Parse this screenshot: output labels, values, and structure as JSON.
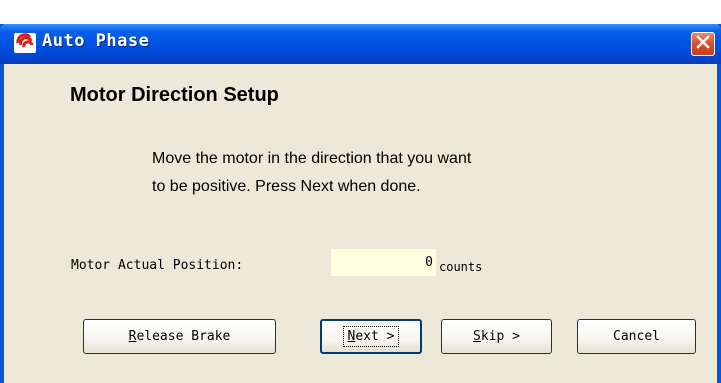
{
  "window": {
    "title": "Auto Phase",
    "app_icon": "auto-phase-logo-icon",
    "close_icon": "close-icon"
  },
  "content": {
    "heading": "Motor Direction Setup",
    "instruction_line1": "Move the motor in the direction that you want",
    "instruction_line2": "to be positive.  Press Next when done."
  },
  "position": {
    "label": "Motor Actual Position:",
    "value": "0",
    "unit": "counts"
  },
  "buttons": {
    "release_brake": {
      "mnemonic": "R",
      "rest": "elease Brake"
    },
    "next": {
      "mnemonic": "N",
      "rest": "ext >"
    },
    "skip": {
      "mnemonic": "S",
      "rest": "kip >"
    },
    "cancel": {
      "label": "Cancel"
    }
  },
  "colors": {
    "titlebar": "#0055e5",
    "dialog_bg": "#ece9d8",
    "field_bg": "#ffffe0",
    "close_button": "#d9512b"
  }
}
